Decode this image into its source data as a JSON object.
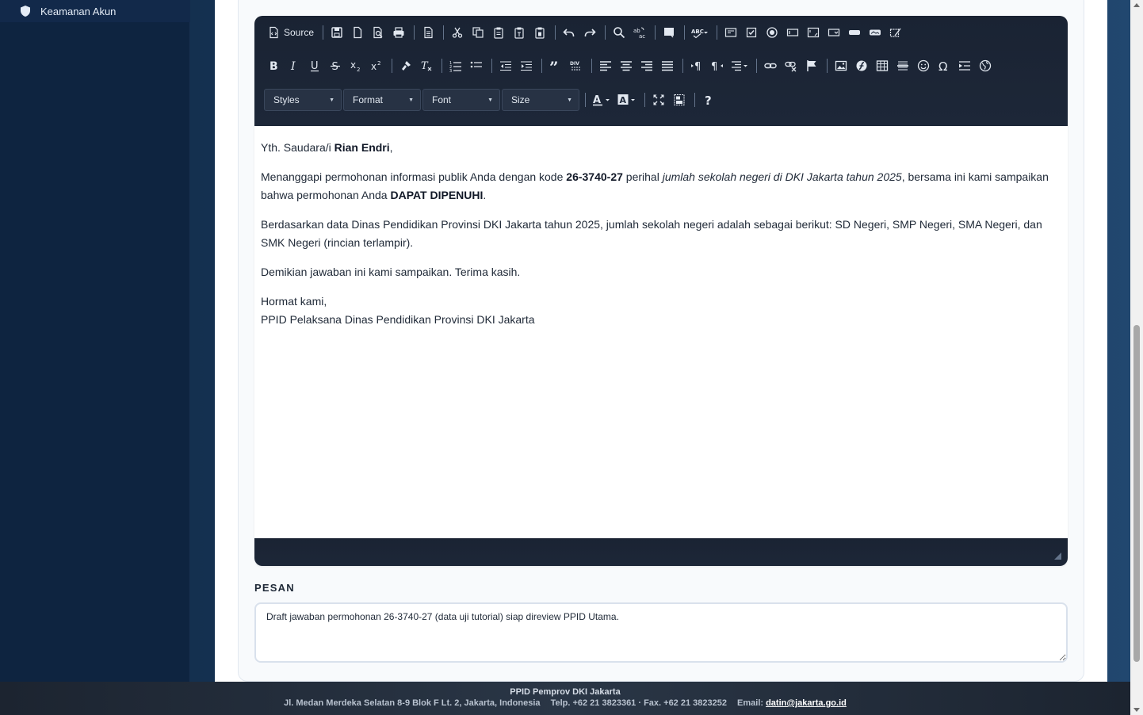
{
  "sidebar": {
    "items": [
      {
        "label": "Keamanan Akun",
        "icon": "shield-icon"
      }
    ]
  },
  "editor": {
    "toolbar": {
      "source_label": "Source",
      "combos": {
        "styles": "Styles",
        "format": "Format",
        "font": "Font",
        "size": "Size"
      },
      "buttons_row1": [
        "save-icon",
        "new-page-icon",
        "preview-icon",
        "print-icon",
        "templates-icon",
        "cut-icon",
        "copy-icon",
        "paste-icon",
        "paste-text-icon",
        "paste-word-icon",
        "undo-icon",
        "redo-icon",
        "find-icon",
        "replace-icon",
        "select-all-icon",
        "spellcheck-icon",
        "form-icon",
        "checkbox-icon",
        "radio-icon",
        "textfield-icon",
        "textarea-icon",
        "select-icon",
        "button-icon",
        "image-button-icon",
        "hidden-field-icon"
      ],
      "buttons_row2": [
        "bold-icon",
        "italic-icon",
        "underline-icon",
        "strike-icon",
        "subscript-icon",
        "superscript-icon",
        "copy-format-icon",
        "remove-format-icon",
        "numbered-list-icon",
        "bulleted-list-icon",
        "outdent-icon",
        "indent-icon",
        "blockquote-icon",
        "div-icon",
        "align-left-icon",
        "align-center-icon",
        "align-right-icon",
        "justify-icon",
        "ltr-icon",
        "rtl-icon",
        "language-icon",
        "link-icon",
        "unlink-icon",
        "anchor-icon",
        "image-icon",
        "flash-icon",
        "table-icon",
        "horizontal-rule-icon",
        "smiley-icon",
        "special-char-icon",
        "page-break-icon",
        "iframe-icon"
      ]
    },
    "content": {
      "greeting_prefix": "Yth. Saudara/i ",
      "greeting_name": "Rian Endri",
      "greeting_suffix": ",",
      "p1_a": "Menanggapi permohonan informasi publik Anda dengan kode ",
      "p1_code": "26-3740-27",
      "p1_b": " perihal ",
      "p1_topic": "jumlah sekolah negeri di DKI Jakarta tahun 2025",
      "p1_c": ", bersama ini kami sampaikan bahwa permohonan Anda ",
      "p1_status": "DAPAT DIPENUHI",
      "p1_d": ".",
      "p2": "Berdasarkan data Dinas Pendidikan Provinsi DKI Jakarta tahun 2025, jumlah sekolah negeri adalah sebagai berikut: SD Negeri, SMP Negeri, SMA Negeri, dan SMK Negeri (rincian terlampir).",
      "p3": "Demikian jawaban ini kami sampaikan. Terima kasih.",
      "closing": "Hormat kami,",
      "signature": "PPID Pelaksana Dinas Pendidikan Provinsi DKI Jakarta"
    }
  },
  "pesan": {
    "label": "PESAN",
    "value": "Draft jawaban permohonan 26-3740-27 (data uji tutorial) siap direview PPID Utama."
  },
  "footer": {
    "org": "PPID Pemprov DKI Jakarta",
    "address": "Jl. Medan Merdeka Selatan 8-9 Blok F Lt. 2, Jakarta, Indonesia",
    "phone": "Telp. +62 21 3823361 · Fax. +62 21 3823252",
    "email_label": "Email:",
    "email": "datin@jakarta.go.id"
  }
}
